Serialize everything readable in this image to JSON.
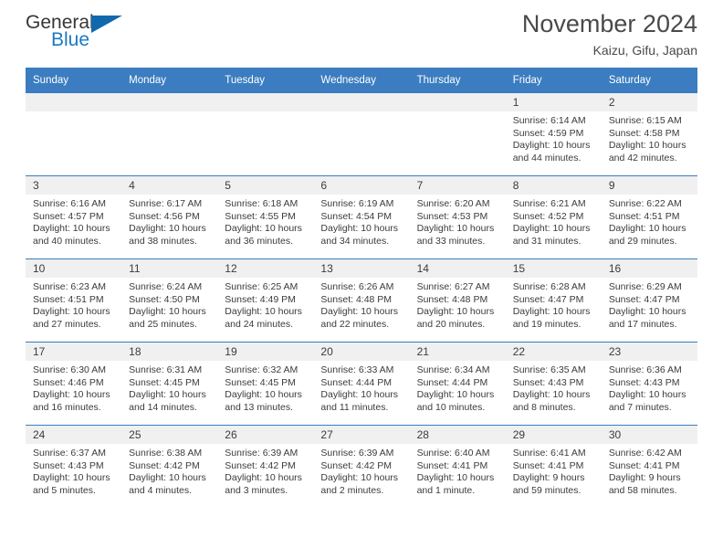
{
  "brand": {
    "name_part1": "General",
    "name_part2": "Blue"
  },
  "header": {
    "title": "November 2024",
    "subtitle": "Kaizu, Gifu, Japan"
  },
  "weekday_headers": [
    "Sunday",
    "Monday",
    "Tuesday",
    "Wednesday",
    "Thursday",
    "Friday",
    "Saturday"
  ],
  "colors": {
    "header_blue": "#3b7dc0",
    "daynum_band": "#f0f0f0",
    "brand_blue": "#1b79c2",
    "text": "#3b3b3b"
  },
  "weeks": [
    [
      {
        "day": "",
        "sunrise": "",
        "sunset": "",
        "daylight1": "",
        "daylight2": "",
        "empty": true
      },
      {
        "day": "",
        "sunrise": "",
        "sunset": "",
        "daylight1": "",
        "daylight2": "",
        "empty": true
      },
      {
        "day": "",
        "sunrise": "",
        "sunset": "",
        "daylight1": "",
        "daylight2": "",
        "empty": true
      },
      {
        "day": "",
        "sunrise": "",
        "sunset": "",
        "daylight1": "",
        "daylight2": "",
        "empty": true
      },
      {
        "day": "",
        "sunrise": "",
        "sunset": "",
        "daylight1": "",
        "daylight2": "",
        "empty": true
      },
      {
        "day": "1",
        "sunrise": "Sunrise: 6:14 AM",
        "sunset": "Sunset: 4:59 PM",
        "daylight1": "Daylight: 10 hours",
        "daylight2": "and 44 minutes."
      },
      {
        "day": "2",
        "sunrise": "Sunrise: 6:15 AM",
        "sunset": "Sunset: 4:58 PM",
        "daylight1": "Daylight: 10 hours",
        "daylight2": "and 42 minutes."
      }
    ],
    [
      {
        "day": "3",
        "sunrise": "Sunrise: 6:16 AM",
        "sunset": "Sunset: 4:57 PM",
        "daylight1": "Daylight: 10 hours",
        "daylight2": "and 40 minutes."
      },
      {
        "day": "4",
        "sunrise": "Sunrise: 6:17 AM",
        "sunset": "Sunset: 4:56 PM",
        "daylight1": "Daylight: 10 hours",
        "daylight2": "and 38 minutes."
      },
      {
        "day": "5",
        "sunrise": "Sunrise: 6:18 AM",
        "sunset": "Sunset: 4:55 PM",
        "daylight1": "Daylight: 10 hours",
        "daylight2": "and 36 minutes."
      },
      {
        "day": "6",
        "sunrise": "Sunrise: 6:19 AM",
        "sunset": "Sunset: 4:54 PM",
        "daylight1": "Daylight: 10 hours",
        "daylight2": "and 34 minutes."
      },
      {
        "day": "7",
        "sunrise": "Sunrise: 6:20 AM",
        "sunset": "Sunset: 4:53 PM",
        "daylight1": "Daylight: 10 hours",
        "daylight2": "and 33 minutes."
      },
      {
        "day": "8",
        "sunrise": "Sunrise: 6:21 AM",
        "sunset": "Sunset: 4:52 PM",
        "daylight1": "Daylight: 10 hours",
        "daylight2": "and 31 minutes."
      },
      {
        "day": "9",
        "sunrise": "Sunrise: 6:22 AM",
        "sunset": "Sunset: 4:51 PM",
        "daylight1": "Daylight: 10 hours",
        "daylight2": "and 29 minutes."
      }
    ],
    [
      {
        "day": "10",
        "sunrise": "Sunrise: 6:23 AM",
        "sunset": "Sunset: 4:51 PM",
        "daylight1": "Daylight: 10 hours",
        "daylight2": "and 27 minutes."
      },
      {
        "day": "11",
        "sunrise": "Sunrise: 6:24 AM",
        "sunset": "Sunset: 4:50 PM",
        "daylight1": "Daylight: 10 hours",
        "daylight2": "and 25 minutes."
      },
      {
        "day": "12",
        "sunrise": "Sunrise: 6:25 AM",
        "sunset": "Sunset: 4:49 PM",
        "daylight1": "Daylight: 10 hours",
        "daylight2": "and 24 minutes."
      },
      {
        "day": "13",
        "sunrise": "Sunrise: 6:26 AM",
        "sunset": "Sunset: 4:48 PM",
        "daylight1": "Daylight: 10 hours",
        "daylight2": "and 22 minutes."
      },
      {
        "day": "14",
        "sunrise": "Sunrise: 6:27 AM",
        "sunset": "Sunset: 4:48 PM",
        "daylight1": "Daylight: 10 hours",
        "daylight2": "and 20 minutes."
      },
      {
        "day": "15",
        "sunrise": "Sunrise: 6:28 AM",
        "sunset": "Sunset: 4:47 PM",
        "daylight1": "Daylight: 10 hours",
        "daylight2": "and 19 minutes."
      },
      {
        "day": "16",
        "sunrise": "Sunrise: 6:29 AM",
        "sunset": "Sunset: 4:47 PM",
        "daylight1": "Daylight: 10 hours",
        "daylight2": "and 17 minutes."
      }
    ],
    [
      {
        "day": "17",
        "sunrise": "Sunrise: 6:30 AM",
        "sunset": "Sunset: 4:46 PM",
        "daylight1": "Daylight: 10 hours",
        "daylight2": "and 16 minutes."
      },
      {
        "day": "18",
        "sunrise": "Sunrise: 6:31 AM",
        "sunset": "Sunset: 4:45 PM",
        "daylight1": "Daylight: 10 hours",
        "daylight2": "and 14 minutes."
      },
      {
        "day": "19",
        "sunrise": "Sunrise: 6:32 AM",
        "sunset": "Sunset: 4:45 PM",
        "daylight1": "Daylight: 10 hours",
        "daylight2": "and 13 minutes."
      },
      {
        "day": "20",
        "sunrise": "Sunrise: 6:33 AM",
        "sunset": "Sunset: 4:44 PM",
        "daylight1": "Daylight: 10 hours",
        "daylight2": "and 11 minutes."
      },
      {
        "day": "21",
        "sunrise": "Sunrise: 6:34 AM",
        "sunset": "Sunset: 4:44 PM",
        "daylight1": "Daylight: 10 hours",
        "daylight2": "and 10 minutes."
      },
      {
        "day": "22",
        "sunrise": "Sunrise: 6:35 AM",
        "sunset": "Sunset: 4:43 PM",
        "daylight1": "Daylight: 10 hours",
        "daylight2": "and 8 minutes."
      },
      {
        "day": "23",
        "sunrise": "Sunrise: 6:36 AM",
        "sunset": "Sunset: 4:43 PM",
        "daylight1": "Daylight: 10 hours",
        "daylight2": "and 7 minutes."
      }
    ],
    [
      {
        "day": "24",
        "sunrise": "Sunrise: 6:37 AM",
        "sunset": "Sunset: 4:43 PM",
        "daylight1": "Daylight: 10 hours",
        "daylight2": "and 5 minutes."
      },
      {
        "day": "25",
        "sunrise": "Sunrise: 6:38 AM",
        "sunset": "Sunset: 4:42 PM",
        "daylight1": "Daylight: 10 hours",
        "daylight2": "and 4 minutes."
      },
      {
        "day": "26",
        "sunrise": "Sunrise: 6:39 AM",
        "sunset": "Sunset: 4:42 PM",
        "daylight1": "Daylight: 10 hours",
        "daylight2": "and 3 minutes."
      },
      {
        "day": "27",
        "sunrise": "Sunrise: 6:39 AM",
        "sunset": "Sunset: 4:42 PM",
        "daylight1": "Daylight: 10 hours",
        "daylight2": "and 2 minutes."
      },
      {
        "day": "28",
        "sunrise": "Sunrise: 6:40 AM",
        "sunset": "Sunset: 4:41 PM",
        "daylight1": "Daylight: 10 hours",
        "daylight2": "and 1 minute."
      },
      {
        "day": "29",
        "sunrise": "Sunrise: 6:41 AM",
        "sunset": "Sunset: 4:41 PM",
        "daylight1": "Daylight: 9 hours",
        "daylight2": "and 59 minutes."
      },
      {
        "day": "30",
        "sunrise": "Sunrise: 6:42 AM",
        "sunset": "Sunset: 4:41 PM",
        "daylight1": "Daylight: 9 hours",
        "daylight2": "and 58 minutes."
      }
    ]
  ]
}
